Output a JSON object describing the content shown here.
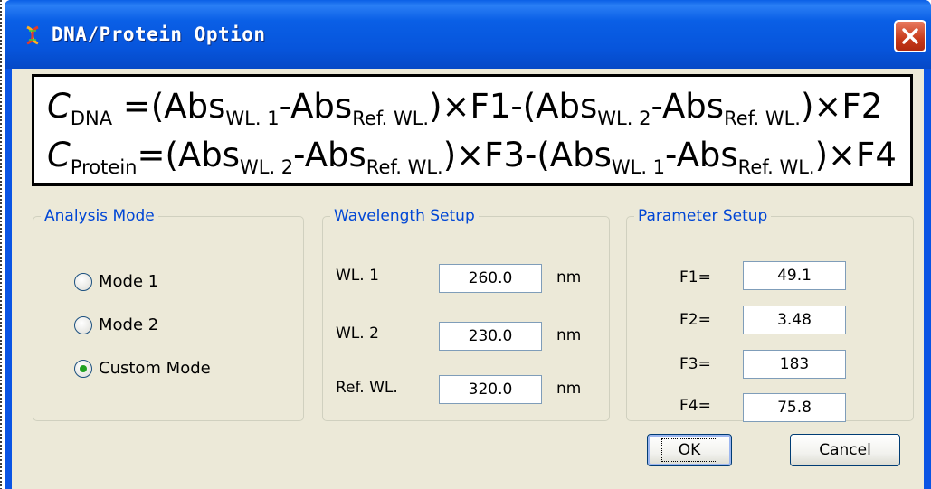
{
  "window": {
    "title": "DNA/Protein Option"
  },
  "formula": {
    "line1": {
      "c": "C",
      "c_sub": "DNA",
      "p1": " =(Abs",
      "s1": "WL. 1",
      "p2": "-Abs",
      "s2": "Ref. WL.",
      "p3": ")×F1-(Abs",
      "s3": "WL. 2",
      "p4": "-Abs",
      "s4": "Ref. WL.",
      "p5": ")×F2"
    },
    "line2": {
      "c": "C",
      "c_sub": "Protein",
      "p1": "=(Abs",
      "s1": "WL. 2",
      "p2": "-Abs",
      "s2": "Ref. WL.",
      "p3": ")×F3-(Abs",
      "s3": "WL. 1",
      "p4": "-Abs",
      "s4": "Ref. WL.",
      "p5": ")×F4"
    }
  },
  "analysis_mode": {
    "legend": "Analysis Mode",
    "options": [
      {
        "label": "Mode 1",
        "selected": false
      },
      {
        "label": "Mode 2",
        "selected": false
      },
      {
        "label": "Custom Mode",
        "selected": true
      }
    ]
  },
  "wavelength_setup": {
    "legend": "Wavelength Setup",
    "rows": [
      {
        "label": "WL. 1",
        "value": "260.0",
        "unit": "nm"
      },
      {
        "label": "WL. 2",
        "value": "230.0",
        "unit": "nm"
      },
      {
        "label": "Ref. WL.",
        "value": "320.0",
        "unit": "nm"
      }
    ]
  },
  "parameter_setup": {
    "legend": "Parameter Setup",
    "rows": [
      {
        "label": "F1=",
        "value": "49.1"
      },
      {
        "label": "F2=",
        "value": "3.48"
      },
      {
        "label": "F3=",
        "value": "183"
      },
      {
        "label": "F4=",
        "value": "75.8"
      }
    ]
  },
  "buttons": {
    "ok": "OK",
    "cancel": "Cancel"
  },
  "colors": {
    "title_bar": "#0a54e4",
    "legend_text": "#0046d5",
    "client_bg": "#ece9d8",
    "close_button": "#c73a1a"
  },
  "icons": {
    "app": "dna-helix-icon",
    "close": "close-icon"
  }
}
